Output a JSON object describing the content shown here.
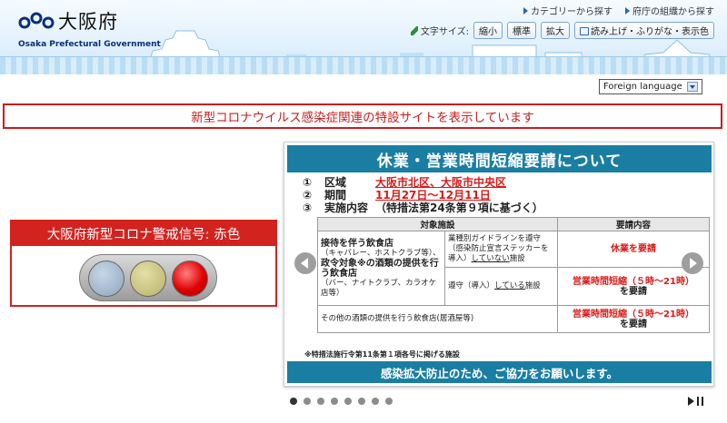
{
  "header": {
    "logo_text": "大阪府",
    "logo_sub": "Osaka Prefectural Government",
    "links": [
      "カテゴリーから探す",
      "府庁の組織から探す"
    ],
    "font_size_label": "文字サイズ:",
    "font_buttons": [
      "縮小",
      "標準",
      "拡大"
    ],
    "reading_button": "読み上げ・ふりがな・表示色",
    "language_select": "Foreign language"
  },
  "notice": {
    "text": "新型コロナウイルス感染症関連の特設サイトを表示しています"
  },
  "alert": {
    "title": "大阪府新型コロナ警戒信号: 赤色",
    "colors": {
      "border": "#d2231f",
      "active_lamp": "#e00000"
    }
  },
  "slide": {
    "title": "休業・営業時間短縮要請について",
    "info": [
      {
        "num": "①",
        "key": "区域",
        "value": "大阪市北区、大阪市中央区"
      },
      {
        "num": "②",
        "key": "期間",
        "value": "11月27日～12月11日"
      },
      {
        "num": "③",
        "key": "実施内容",
        "value": "（特措法第24条第９項に基づく）"
      }
    ],
    "table": {
      "headers": [
        "対象施設",
        "要請内容"
      ],
      "row1": {
        "cat_main": "接待を伴う飲食店",
        "cat_sub": "（キャバレー、ホストクラブ等）、",
        "sub_cond_1": "業種別ガイドラインを遵守（感染防止宣言ステッカーを導入）",
        "sub_cond_1_emph": "していない",
        "sub_cond_1_tail": "施設",
        "req_1": "休業を要請"
      },
      "row2": {
        "cat_main": "政令対象※の酒類の提供を行う飲食店",
        "cat_sub": "（バー、ナイトクラブ、カラオケ店等）",
        "sub_cond_2": "遵守（導入）",
        "sub_cond_2_emph": "している",
        "sub_cond_2_tail": "施設",
        "req_2_red": "営業時間短縮（５時～21時）",
        "req_2_black": "を要請"
      },
      "row3": {
        "cat": "その他の酒類の提供を行う飲食店(居酒屋等)",
        "req_3_red": "営業時間短縮（５時～21時）",
        "req_3_black": "を要請"
      }
    },
    "footnote": "※特措法施行令第11条第１項各号に掲げる施設",
    "footer": "感染拡大防止のため、ご協力をお願いします。",
    "colors": {
      "band": "#1a7ea3",
      "emphasis": "#d81b1b"
    }
  },
  "slider": {
    "dot_count": 8,
    "active_dot": 0
  }
}
